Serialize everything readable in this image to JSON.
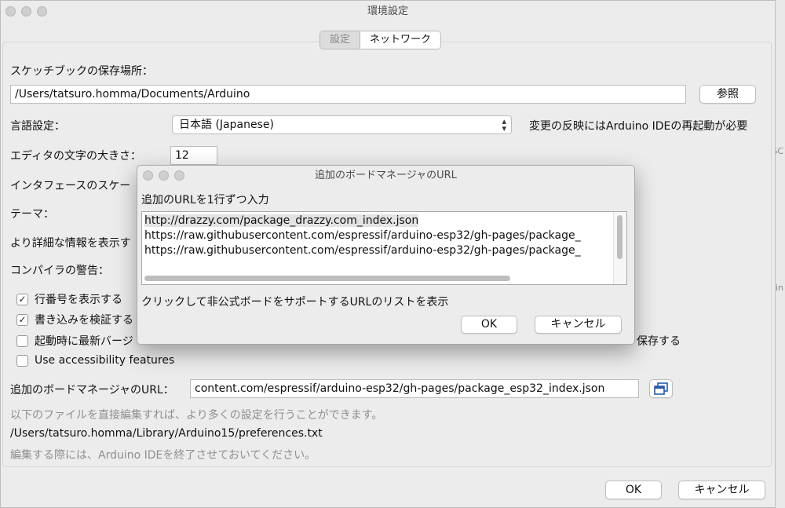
{
  "background": {
    "side_fragment_1": "SC",
    "side_fragment_2": "in"
  },
  "prefs": {
    "title": "環境設定",
    "tabs": [
      {
        "label": "設定",
        "active": false
      },
      {
        "label": "ネットワーク",
        "active": true
      }
    ],
    "sketchbook": {
      "label": "スケッチブックの保存場所：",
      "path": "/Users/tatsuro.homma/Documents/Arduino",
      "browse": "参照"
    },
    "language": {
      "label": "言語設定：",
      "value": "日本語 (Japanese)",
      "note": "変更の反映にはArduino IDEの再起動が必要"
    },
    "editor_font": {
      "label": "エディタの文字の大きさ：",
      "value": "12"
    },
    "interface_scale": {
      "label": "インタフェースのスケー"
    },
    "theme": {
      "label": "テーマ："
    },
    "verbose": {
      "label": "より詳細な情報を表示す"
    },
    "compiler_warnings": {
      "label": "コンパイラの警告："
    },
    "checkboxes": [
      {
        "label": "行番号を表示する",
        "checked": true
      },
      {
        "label": "書き込みを検証する",
        "checked": true
      },
      {
        "label": "起動時に最新バージ",
        "checked": false
      },
      {
        "label": "Use accessibility features",
        "checked": false
      }
    ],
    "save_partial": "保存する",
    "board_urls": {
      "label": "追加のボードマネージャのURL：",
      "value": "content.com/espressif/arduino-esp32/gh-pages/package_esp32_index.json"
    },
    "more_settings_note": "以下のファイルを直接編集すれば、より多くの設定を行うことができます。",
    "prefs_path": "/Users/tatsuro.homma/Library/Arduino15/preferences.txt",
    "close_note": "編集する際には、Arduino IDEを終了させておいてください。",
    "ok": "OK",
    "cancel": "キャンセル"
  },
  "dialog": {
    "title": "追加のボードマネージャのURL",
    "instruction": "追加のURLを1行ずつ入力",
    "urls": [
      "http://drazzy.com/package_drazzy.com_index.json",
      "https://raw.githubusercontent.com/espressif/arduino-esp32/gh-pages/package_",
      "https://raw.githubusercontent.com/espressif/arduino-esp32/gh-pages/package_"
    ],
    "link_text": "クリックして非公式ボードをサポートするURLのリストを表示",
    "ok": "OK",
    "cancel": "キャンセル"
  }
}
